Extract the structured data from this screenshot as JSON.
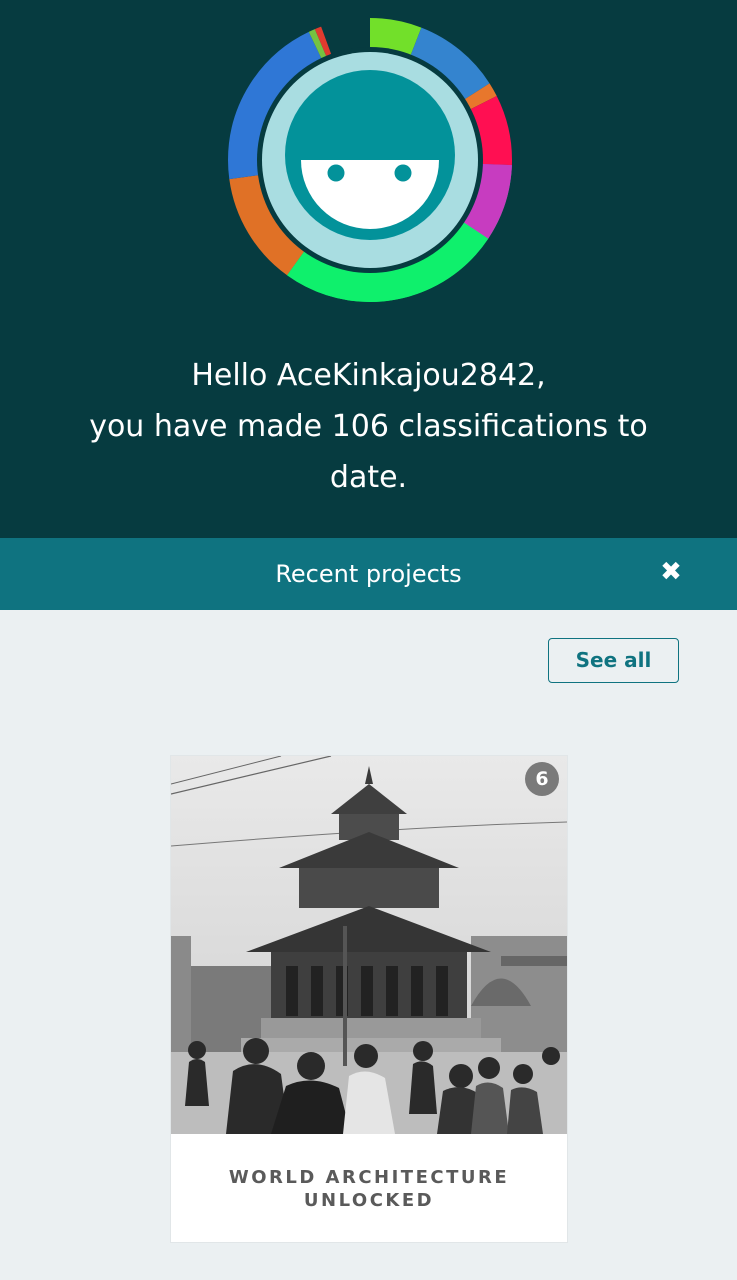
{
  "header": {
    "greeting_line1": "Hello AceKinkajou2842,",
    "greeting_line2": "you have made 106 classifications to",
    "greeting_line3": "date.",
    "avatar_icon": "zooniverse-smiley-avatar",
    "ring_colors": [
      "#72e02a",
      "#3484cf",
      "#e8772c",
      "#ff0f52",
      "#c73cc0",
      "#0ff06c",
      "#e07126",
      "#2f77d6",
      "#75c241",
      "#e03b2f"
    ]
  },
  "recent_projects": {
    "title": "Recent projects",
    "close_icon": "close-icon",
    "see_all_label": "See all",
    "projects": [
      {
        "title": "WORLD ARCHITECTURE UNLOCKED",
        "title_line1": "WORLD ARCHITECTURE",
        "title_line2": "UNLOCKED",
        "badge_count": "6",
        "image": "black-and-white photo of a pagoda temple with a crowd"
      }
    ]
  },
  "colors": {
    "hero_bg": "#063b40",
    "bar_bg": "#0f7380",
    "page_bg": "#ebf0f2",
    "accent": "#0f7380"
  }
}
